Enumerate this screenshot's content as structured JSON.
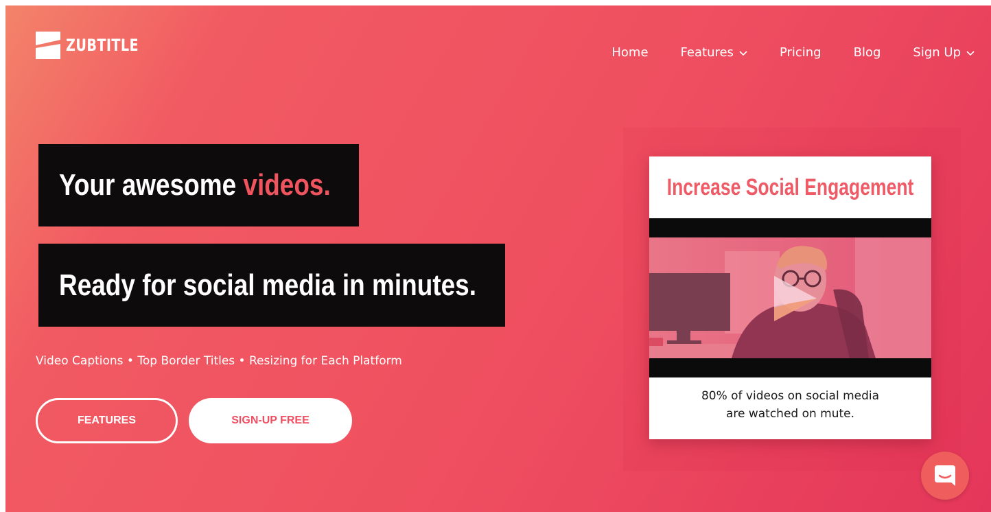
{
  "brand": {
    "name": "ZUBTITLE",
    "logo_icon": "zubtitle-z-logo-icon"
  },
  "nav": {
    "items": [
      {
        "label": "Home",
        "has_dropdown": false
      },
      {
        "label": "Features",
        "has_dropdown": true
      },
      {
        "label": "Pricing",
        "has_dropdown": false
      },
      {
        "label": "Blog",
        "has_dropdown": false
      },
      {
        "label": "Sign Up",
        "has_dropdown": true
      }
    ]
  },
  "hero": {
    "headline_1_prefix": "Your awesome ",
    "headline_1_accent": "videos.",
    "headline_2": "Ready for social media in minutes.",
    "tagline": "Video Captions • Top Border Titles • Resizing for Each Platform",
    "primary_button": "FEATURES",
    "secondary_button": "SIGN-UP FREE"
  },
  "preview_card": {
    "title": "Increase Social Engagement",
    "caption_line_1": "80% of videos on social media",
    "caption_line_2": "are watched on mute.",
    "play_icon": "play-icon"
  },
  "chat": {
    "icon": "chat-bubble-icon"
  },
  "colors": {
    "accent": "#ef4f60",
    "gradient_start": "#f3836a",
    "gradient_end": "#e4365a",
    "title_box": "#0d0b0b",
    "chat_button": "#ef5d5c"
  }
}
